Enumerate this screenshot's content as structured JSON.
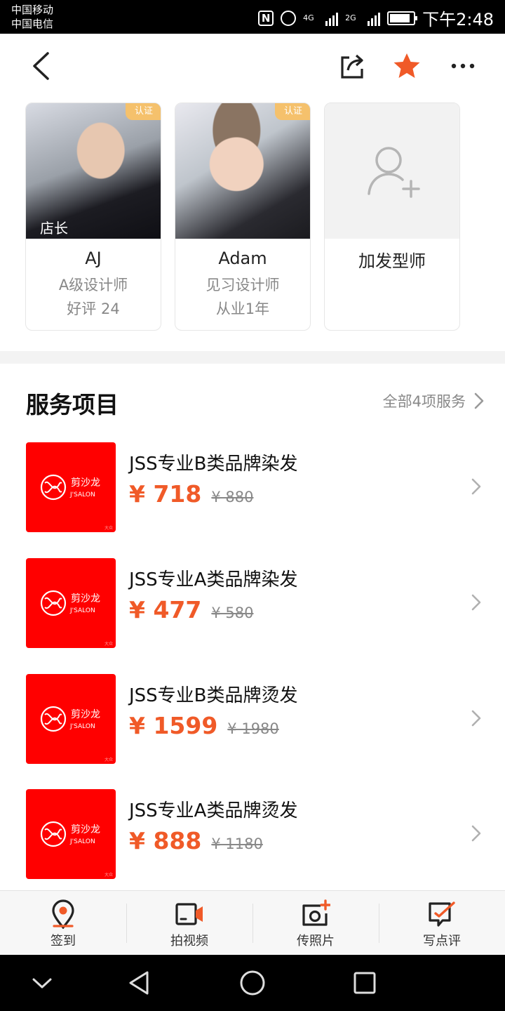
{
  "status_bar": {
    "carrier_1": "中国移动",
    "carrier_2": "中国电信",
    "nfc_icon": "N",
    "net_1": "4G",
    "net_2": "2G",
    "time": "下午2:48"
  },
  "nav": {
    "back_icon": "chevron-left",
    "share_icon": "share",
    "favorite_icon": "star",
    "more_icon": "more-dots",
    "accent": "#f05a28"
  },
  "stylists": [
    {
      "name": "AJ",
      "title": "A级设计师",
      "detail": "好评 24",
      "badge": "认证",
      "tag": "店长"
    },
    {
      "name": "Adam",
      "title": "见习设计师",
      "detail": "从业1年",
      "badge": "认证"
    },
    {
      "name": "加发型师"
    }
  ],
  "services_section": {
    "title": "服务项目",
    "more": "全部4项服务"
  },
  "services": [
    {
      "name": "JSS专业B类品牌染发",
      "price": "¥ 718",
      "original_price": "¥ 880",
      "logo_cn": "剪沙龙",
      "logo_en": "J'SALON",
      "watermark": "大众"
    },
    {
      "name": "JSS专业A类品牌染发",
      "price": "¥ 477",
      "original_price": "¥ 580",
      "logo_cn": "剪沙龙",
      "logo_en": "J'SALON",
      "watermark": "大众"
    },
    {
      "name": "JSS专业B类品牌烫发",
      "price": "¥ 1599",
      "original_price": "¥ 1980",
      "logo_cn": "剪沙龙",
      "logo_en": "J'SALON",
      "watermark": "大众"
    },
    {
      "name": "JSS专业A类品牌烫发",
      "price": "¥ 888",
      "original_price": "¥ 1180",
      "logo_cn": "剪沙龙",
      "logo_en": "J'SALON",
      "watermark": "大众"
    }
  ],
  "bottom_bar": [
    {
      "label": "签到",
      "icon": "location-pin"
    },
    {
      "label": "拍视频",
      "icon": "video-camera"
    },
    {
      "label": "传照片",
      "icon": "photo-upload"
    },
    {
      "label": "写点评",
      "icon": "write-review"
    }
  ],
  "system_nav": {
    "icons": [
      "chevron-down",
      "back-triangle",
      "home-circle",
      "recents-square"
    ]
  }
}
